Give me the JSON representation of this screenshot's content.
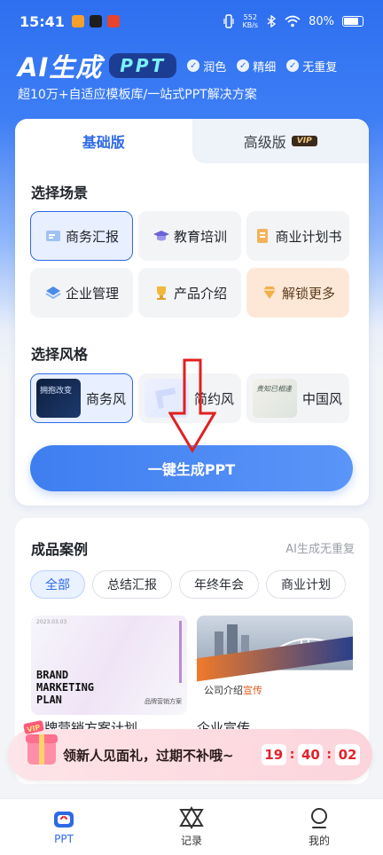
{
  "status": {
    "time": "15:41",
    "net_speed_value": "552",
    "net_speed_unit": "KB/s",
    "battery": "80%",
    "battery_level": 0.8
  },
  "hero": {
    "brand_title": "AI生成",
    "brand_pill": "PPT",
    "features": [
      "润色",
      "精细",
      "无重复"
    ],
    "subtitle": "超10万+自适应模板库/一站式PPT解决方案"
  },
  "generator": {
    "tabs": {
      "basic": "基础版",
      "advanced": "高级版",
      "vip_tag": "VIP"
    },
    "scene_title": "选择场景",
    "scenes": [
      "商务汇报",
      "教育培训",
      "商业计划书",
      "企业管理",
      "产品介绍",
      "解锁更多"
    ],
    "style_title": "选择风格",
    "styles": [
      "商务风",
      "简约风",
      "中国风"
    ],
    "style_thumb_business": "拥抱改变",
    "style_thumb_china": "贵知已相逢",
    "generate_label": "一键生成PPT"
  },
  "cases": {
    "title": "成品案例",
    "tagline": "AI生成无重复",
    "filters": [
      "全部",
      "总结汇报",
      "年终年会",
      "商业计划"
    ],
    "case1": {
      "tag": "2023.03.03",
      "title_lines": [
        "BRAND",
        "MARKETING",
        "PLAN"
      ],
      "sub": "品牌营销方案",
      "caption": "品牌营销方案计划"
    },
    "case2": {
      "title": "公司介绍",
      "title_accent": "宣传",
      "caption": "企业宣传"
    }
  },
  "promo": {
    "text": "领新人见面礼，过期不补哦~",
    "hours": "19",
    "minutes": "40",
    "seconds": "02",
    "gift_label": "VIP"
  },
  "tabbar": {
    "items": [
      "PPT",
      "记录",
      "我的"
    ]
  },
  "colors": {
    "accent": "#2d6ae6",
    "hero_blue": "#2e6ff0",
    "countdown_red": "#e5212c",
    "arrow_red": "#e02020"
  }
}
